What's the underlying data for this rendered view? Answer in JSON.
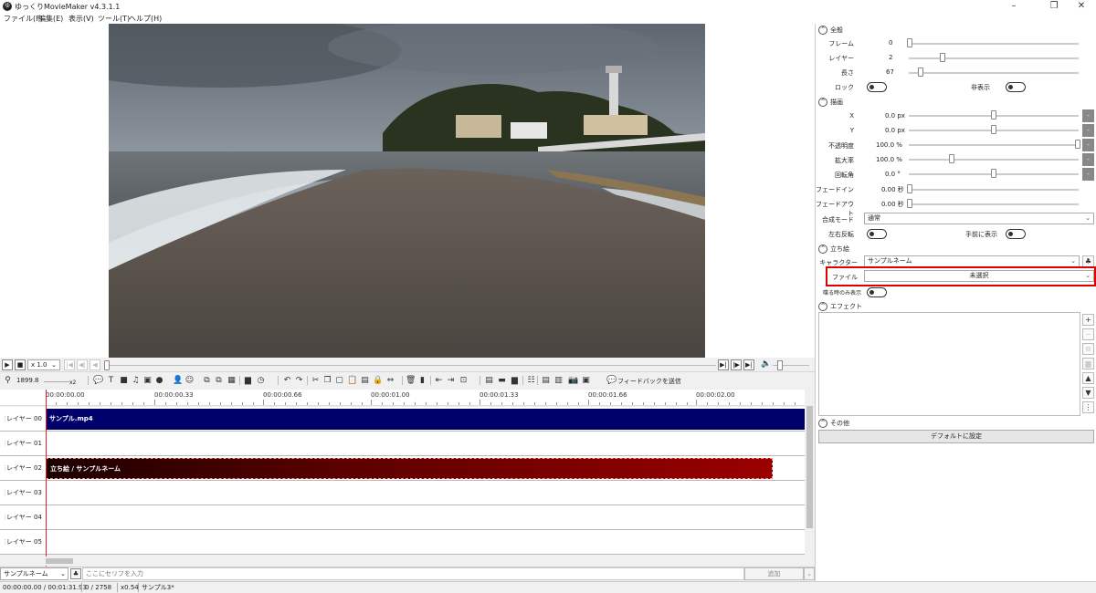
{
  "window": {
    "title": "ゆっくりMovieMaker v4.3.1.1",
    "logo_text": "ゆ",
    "minimize": "–",
    "maximize": "❐",
    "close": "✕"
  },
  "menu": [
    "ファイル(F)",
    "編集(E)",
    "表示(V)",
    "ツール(T)",
    "ヘルプ(H)"
  ],
  "playback": {
    "speed": "x 1.0",
    "speed_arrow": "⌄",
    "seek_position": 0.0,
    "volume_level": 0.1
  },
  "toolbar": {
    "zoom_value": "1899.8",
    "zoom_multiplier": "x2",
    "feedback_label": "フィードバックを送信"
  },
  "timeline": {
    "ruler_labels": [
      "00:00:00.00",
      "00:00:00.33",
      "00:00:00.66",
      "00:00:01.00",
      "00:00:01.33",
      "00:00:01.66",
      "00:00:02.00"
    ],
    "layers": [
      {
        "label": "レイヤー 00",
        "clip": "サンプル.mp4"
      },
      {
        "label": "レイヤー 01",
        "clip": ""
      },
      {
        "label": "レイヤー 02",
        "clip": "立ち絵 / サンプルネーム"
      },
      {
        "label": "レイヤー 03",
        "clip": ""
      },
      {
        "label": "レイヤー 04",
        "clip": ""
      },
      {
        "label": "レイヤー 05",
        "clip": ""
      }
    ]
  },
  "serif": {
    "character": "サンプルネーム",
    "placeholder": "ここにセリフを入力",
    "add_label": "追加"
  },
  "status": {
    "time": "00:00:00.00  /  00:01:31.93",
    "frame": "0  /  2758",
    "zoom": "x0.54",
    "project": "サンプル3*"
  },
  "properties": {
    "sections": {
      "general": "全般",
      "drawing": "描画",
      "tachie": "立ち絵",
      "effect": "エフェクト",
      "other": "その他"
    },
    "general": {
      "frame_label": "フレーム",
      "frame_value": "0",
      "layer_label": "レイヤー",
      "layer_value": "2",
      "length_label": "長さ",
      "length_value": "67",
      "lock_label": "ロック",
      "hide_label": "非表示"
    },
    "drawing": {
      "x_label": "X",
      "x_value": "0.0 px",
      "y_label": "Y",
      "y_value": "0.0 px",
      "opacity_label": "不透明度",
      "opacity_value": "100.0 %",
      "scale_label": "拡大率",
      "scale_value": "100.0 %",
      "rotation_label": "回転角",
      "rotation_value": "0.0 °",
      "fadein_label": "フェードイン",
      "fadein_value": "0.00 秒",
      "fadeout_label": "フェードアウト",
      "fadeout_value": "0.00 秒",
      "blend_label": "合成モード",
      "blend_value": "通常",
      "flip_label": "左右反転",
      "front_label": "手前に表示"
    },
    "tachie": {
      "character_label": "キャラクター",
      "character_value": "サンプルネーム",
      "file_label": "ファイル",
      "file_value": "未選択",
      "speaking_only_label": "喋る時のみ表示"
    },
    "default_button": "デフォルトに設定",
    "mini_button": "-"
  }
}
